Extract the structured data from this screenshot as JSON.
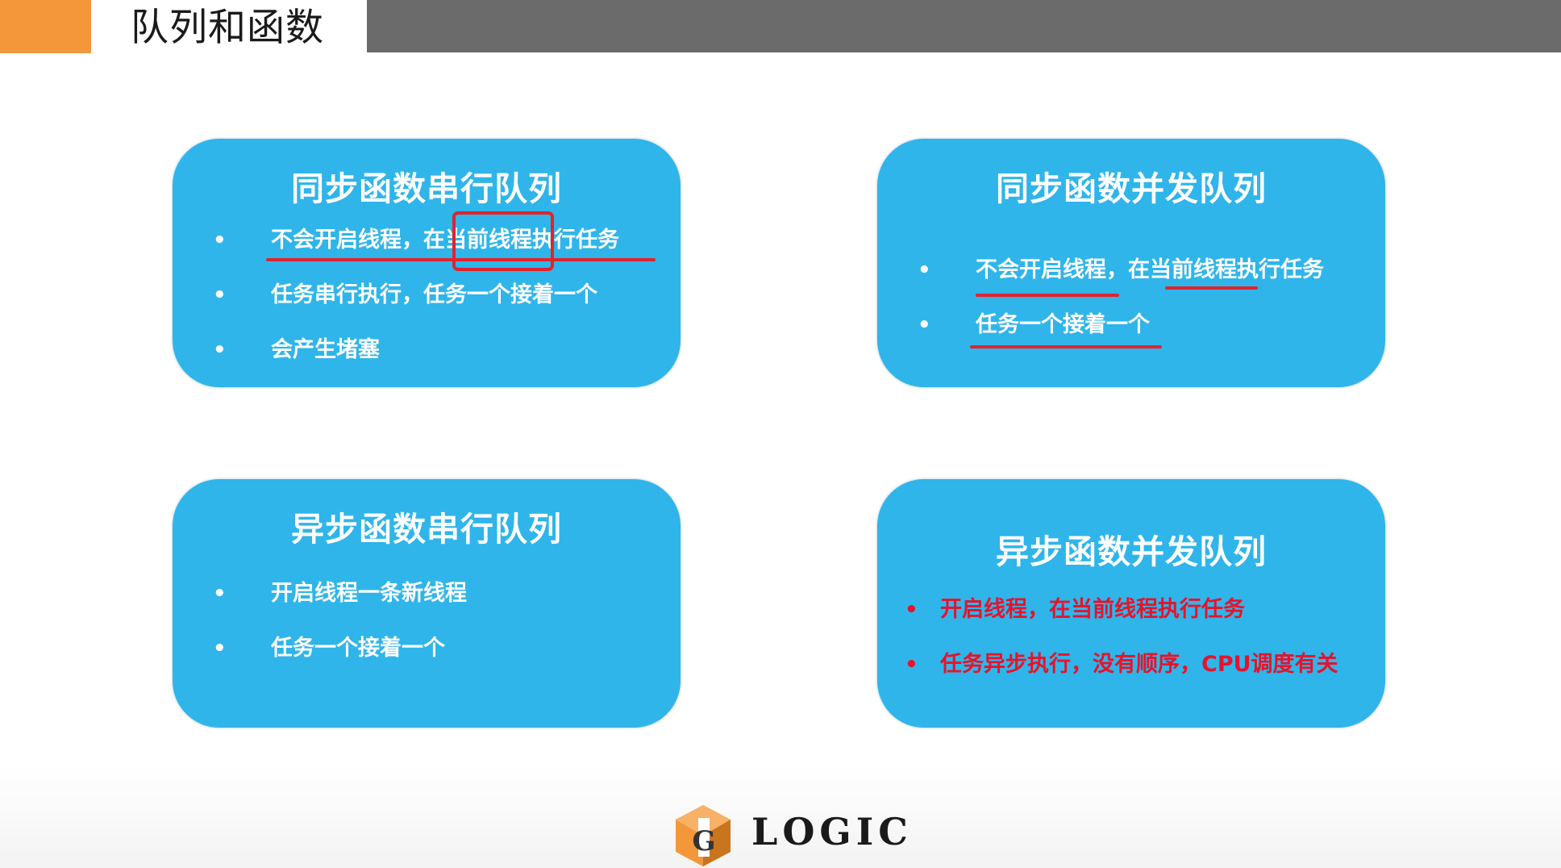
{
  "header": {
    "title": "队列和函数",
    "colors": {
      "orange": "#f3973a",
      "gray": "#6b6b6b"
    }
  },
  "cards": [
    {
      "title": "同步函数串行队列",
      "items": [
        "不会开启线程，在当前线程执行任务",
        "任务串行执行，任务一个接着一个",
        "会产生堵塞"
      ]
    },
    {
      "title": "同步函数并发队列",
      "items": [
        "不会开启线程，在当前线程执行任务",
        "任务一个接着一个"
      ]
    },
    {
      "title": "异步函数串行队列",
      "items": [
        "开启线程一条新线程",
        "任务一个接着一个"
      ]
    },
    {
      "title": "异步函数并发队列",
      "items": [
        "开启线程，在当前线程执行任务",
        "任务异步执行，没有顺序，CPU调度有关"
      ]
    }
  ],
  "colors": {
    "card_blue": "#2fb5ea",
    "annotation_red": "#e3222b",
    "highlight_text_red": "#e8122a"
  },
  "logo": {
    "text": "LOGIC",
    "icon": "logic-g-icon"
  },
  "bullet_glyph": "•"
}
